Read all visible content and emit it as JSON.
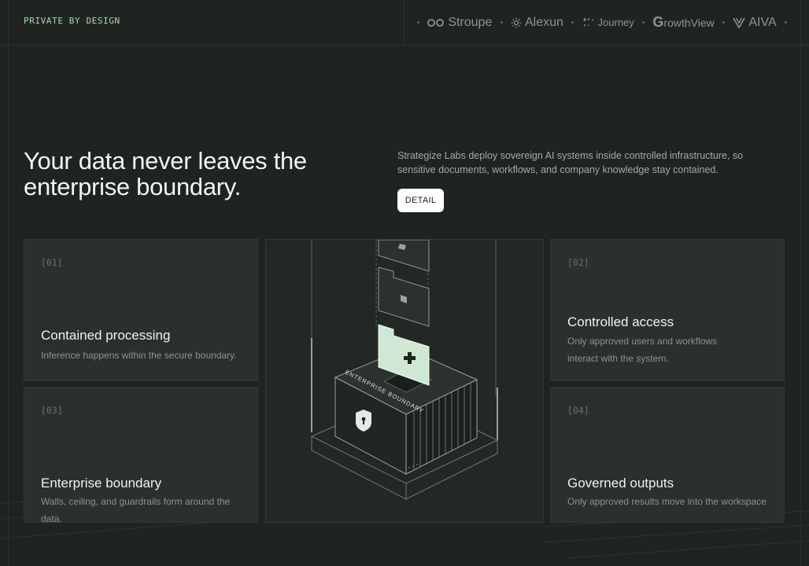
{
  "header": {
    "tag": "PRIVATE BY DESIGN",
    "logos": [
      {
        "name": "Stroupe",
        "icon": "double-circle-icon"
      },
      {
        "name": "Alexun",
        "icon": "sun-icon"
      },
      {
        "name": "Journey",
        "icon": "dots-icon"
      },
      {
        "name": "rowthView",
        "prefix": "G",
        "icon": "g-letter-icon"
      },
      {
        "name": "AIVA",
        "icon": "aiva-mark-icon"
      }
    ]
  },
  "hero": {
    "headline": "Your data never leaves the enterprise boundary.",
    "description": "Strategize Labs deploy sovereign AI systems inside controlled infrastructure, so sensitive documents, workflows, and company knowledge stay contained.",
    "button_label": "DETAIL"
  },
  "illustration": {
    "boundary_label": "ENTERPRISE BOUNDARY",
    "accent": "#cfe8d6"
  },
  "cards": [
    {
      "num": "[01]",
      "title": "Contained processing",
      "sub": "Inference happens within the secure boundary."
    },
    {
      "num": "[02]",
      "title": "Controlled access",
      "sub": "Only approved users and workflows interact with the system."
    },
    {
      "num": "[03]",
      "title": "Enterprise boundary",
      "sub": "Walls, ceiling, and guardrails form around the data."
    },
    {
      "num": "[04]",
      "title": "Governed outputs",
      "sub": "Only approved results move into the workspace"
    }
  ],
  "colors": {
    "background": "#1f2421",
    "card": "#2a302c",
    "tag": "#a6d8b6"
  }
}
